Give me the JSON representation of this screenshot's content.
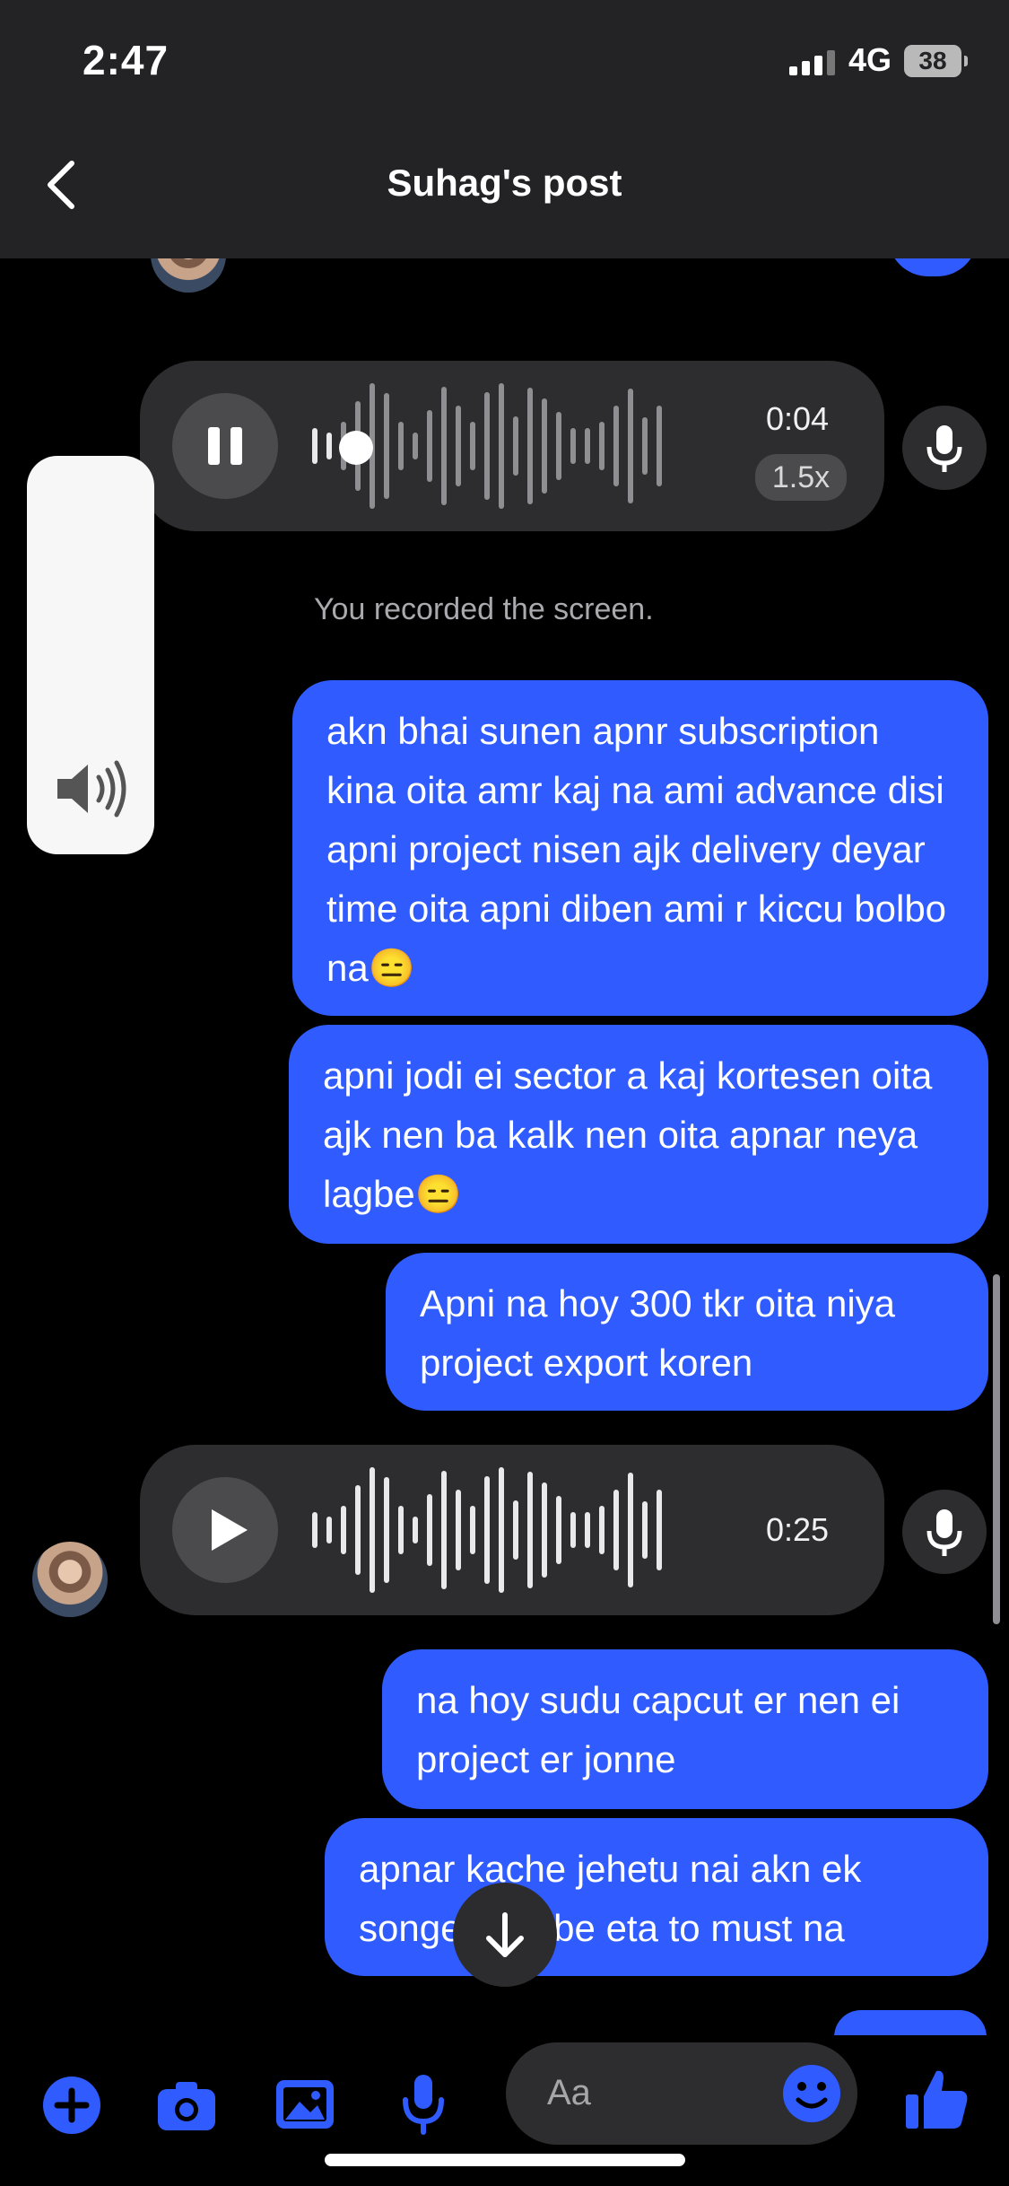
{
  "status_bar": {
    "time": "2:47",
    "network": "4G",
    "battery": "38"
  },
  "header": {
    "title": "Suhag's post"
  },
  "chat": {
    "voice_messages": [
      {
        "duration": "0:04",
        "speed": "1.5x",
        "state": "playing",
        "progress": 0.1
      },
      {
        "duration": "0:25",
        "state": "paused"
      }
    ],
    "system_note": "You recorded the screen.",
    "messages": [
      {
        "text": "akn bhai sunen apnr subscription kina oita amr kaj na ami advance disi apni project nisen ajk delivery deyar time oita apni diben ami r kiccu bolbo na😑"
      },
      {
        "text": "apni jodi ei sector a kaj kortesen oita ajk nen ba kalk nen oita apnar neya lagbe😑"
      },
      {
        "text": "Apni na hoy 300 tkr oita niya project export koren"
      },
      {
        "text": "na hoy sudu capcut er nen ei project er jonne"
      },
      {
        "text": "apnar kache jehetu nai akn ek songe a lagbe eta to must na"
      }
    ]
  },
  "composer": {
    "placeholder": "Aa"
  },
  "icons": {
    "back": "chevron-left-icon",
    "pause": "pause-icon",
    "play": "play-icon",
    "mic": "microphone-icon",
    "volume": "speaker-icon",
    "scroll_down": "arrow-down-icon",
    "add": "plus-circle-icon",
    "camera": "camera-icon",
    "gallery": "image-icon",
    "voice": "microphone-icon",
    "emoji": "smiley-icon",
    "like": "thumbs-up-icon"
  },
  "colors": {
    "accent": "#2f5bff",
    "bubble_in": "#2d2d2f",
    "header_bg": "#232325"
  }
}
